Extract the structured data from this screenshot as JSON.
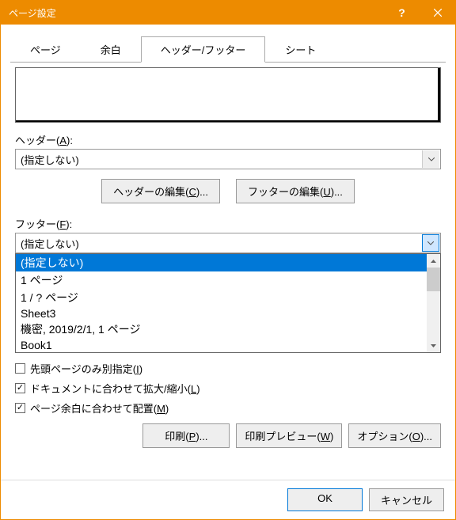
{
  "title": "ページ設定",
  "tabs": [
    "ページ",
    "余白",
    "ヘッダー/フッター",
    "シート"
  ],
  "header": {
    "label_pre": "ヘッダー(",
    "key": "A",
    "label_post": "):",
    "value": "(指定しない)"
  },
  "editHeader": {
    "pre": "ヘッダーの編集(",
    "key": "C",
    "post": ")..."
  },
  "editFooter": {
    "pre": "フッターの編集(",
    "key": "U",
    "post": ")..."
  },
  "footerField": {
    "label_pre": "フッター(",
    "key": "F",
    "label_post": "):",
    "value": "(指定しない)"
  },
  "footerOptions": [
    "(指定しない)",
    "1 ページ",
    "1 / ? ページ",
    "Sheet3",
    " 機密, 2019/2/1, 1 ページ",
    "Book1"
  ],
  "checks": {
    "firstPage": {
      "checked": false,
      "pre": "先頭ページのみ別指定(",
      "key": "I",
      "post": ")"
    },
    "scale": {
      "checked": true,
      "pre": "ドキュメントに合わせて拡大/縮小(",
      "key": "L",
      "post": ")"
    },
    "margin": {
      "checked": true,
      "pre": "ページ余白に合わせて配置(",
      "key": "M",
      "post": ")"
    }
  },
  "actions": {
    "print": {
      "pre": "印刷(",
      "key": "P",
      "post": ")..."
    },
    "preview": {
      "pre": "印刷プレビュー(",
      "key": "W",
      "post": ")"
    },
    "options": {
      "pre": "オプション(",
      "key": "O",
      "post": ")..."
    }
  },
  "dlg": {
    "ok": "OK",
    "cancel": "キャンセル"
  }
}
